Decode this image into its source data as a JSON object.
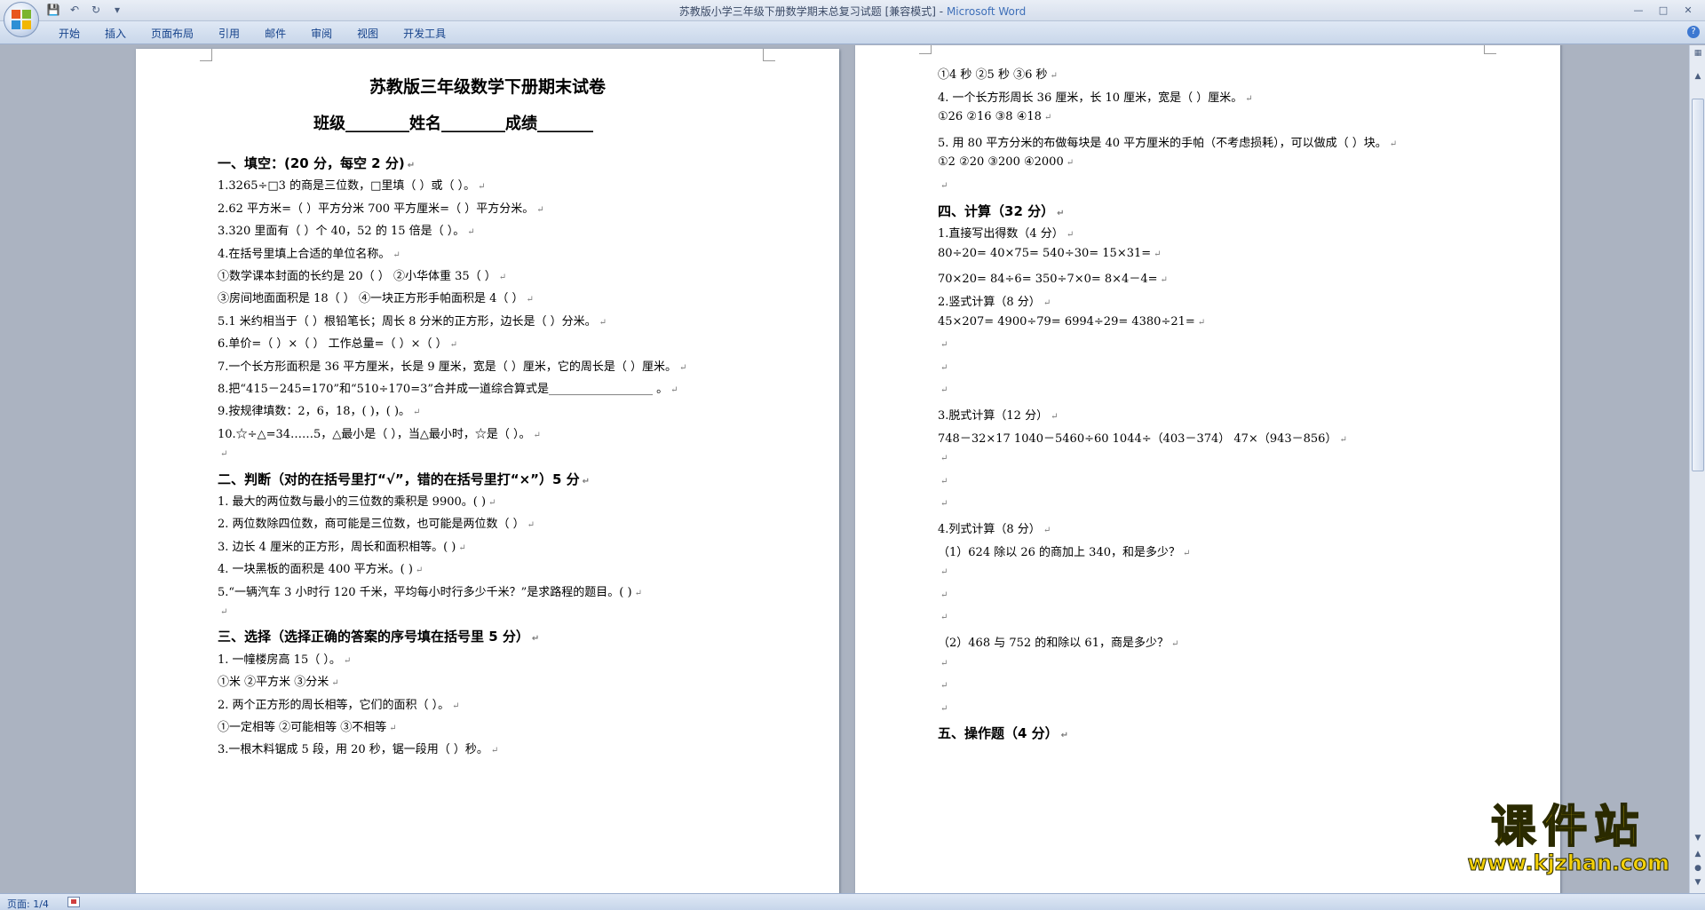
{
  "titlebar": {
    "doc_title": "苏教版小学三年级下册数学期末总复习试题 [兼容模式] -",
    "app_name": "Microsoft Word"
  },
  "ribbon": {
    "tabs": [
      "开始",
      "插入",
      "页面布局",
      "引用",
      "邮件",
      "审阅",
      "视图",
      "开发工具"
    ]
  },
  "page1": {
    "title": "苏教版三年级数学下册期末试卷",
    "info": "班级________姓名________成绩_______",
    "lines": [
      {
        "kind": "head",
        "text": "一、填空：(20 分，每空 2 分)"
      },
      {
        "kind": "body",
        "text": "1.3265÷□3 的商是三位数，□里填（      ）或（        ）。"
      },
      {
        "kind": "body",
        "text": "2.62 平方米=（      ）平方分米      700 平方厘米=（      ）平方分米。"
      },
      {
        "kind": "body",
        "text": "3.320 里面有（      ）个 40，52 的 15 倍是（      ）。"
      },
      {
        "kind": "body",
        "text": "4.在括号里填上合适的单位名称。"
      },
      {
        "kind": "body",
        "text": "①数学课本封面的长约是 20（       ）          ②小华体重 35（       ）"
      },
      {
        "kind": "body",
        "text": "③房间地面面积是 18（        ）              ④一块正方形手帕面积是 4（      ）"
      },
      {
        "kind": "body",
        "text": "5.1 米约相当于（      ）根铅笔长；周长 8 分米的正方形，边长是（      ）分米。"
      },
      {
        "kind": "body",
        "text": "6.单价=（        ）×（        ）           工作总量=（        ）×（        ）"
      },
      {
        "kind": "body",
        "text": "7.一个长方形面积是 36 平方厘米，长是 9 厘米，宽是（      ）厘米，它的周长是（    ）厘米。"
      },
      {
        "kind": "body",
        "text": "8.把“415－245=170”和“510÷170=3”合并成一道综合算式是__________________ 。"
      },
      {
        "kind": "body",
        "text": "9.按规律填数：2，6，18，(        )，(        )。"
      },
      {
        "kind": "body",
        "text": "10.☆÷△=34……5，△最小是（      ），当△最小时，☆是（      ）。"
      },
      {
        "kind": "empty",
        "text": ""
      },
      {
        "kind": "head",
        "text": "二、判断（对的在括号里打“√”，错的在括号里打“×”）5 分"
      },
      {
        "kind": "body",
        "text": "1. 最大的两位数与最小的三位数的乘积是 9900。(       )"
      },
      {
        "kind": "body",
        "text": "2. 两位数除四位数，商可能是三位数，也可能是两位数（      ）"
      },
      {
        "kind": "body",
        "text": "3. 边长 4 厘米的正方形，周长和面积相等。(      )"
      },
      {
        "kind": "body",
        "text": "4. 一块黑板的面积是 400 平方米。(        )"
      },
      {
        "kind": "body",
        "text": "5.“一辆汽车 3 小时行 120 千米，平均每小时行多少千米？”是求路程的题目。(      )"
      },
      {
        "kind": "empty",
        "text": ""
      },
      {
        "kind": "head",
        "text": "三、选择（选择正确的答案的序号填在括号里 5 分）"
      },
      {
        "kind": "body",
        "text": "1. 一幢楼房高 15（      ）。"
      },
      {
        "kind": "body",
        "text": "①米            ②平方米          ③分米"
      },
      {
        "kind": "body",
        "text": "2. 两个正方形的周长相等，它们的面积（  ）。"
      },
      {
        "kind": "body",
        "text": "①一定相等      ②可能相等      ③不相等"
      },
      {
        "kind": "body",
        "text": "3.一根木料锯成 5 段，用 20 秒，锯一段用（      ）秒。"
      }
    ]
  },
  "page2": {
    "lines": [
      {
        "kind": "body",
        "text": "①4 秒     ②5 秒      ③6 秒"
      },
      {
        "kind": "body",
        "text": "4. 一个长方形周长 36 厘米，长 10 厘米，宽是（      ）厘米。"
      },
      {
        "kind": "body",
        "text": "①26             ②16                ③8              ④18"
      },
      {
        "kind": "body",
        "text": "5. 用 80 平方分米的布做每块是 40 平方厘米的手帕（不考虑损耗），可以做成（   ）块。"
      },
      {
        "kind": "body",
        "text": "①2               ②20                ③200             ④2000"
      },
      {
        "kind": "empty",
        "text": ""
      },
      {
        "kind": "head",
        "text": "四、计算（32 分）"
      },
      {
        "kind": "body",
        "text": "1.直接写出得数（4 分）"
      },
      {
        "kind": "body",
        "text": "80÷20=          40×75=            540÷30=            15×31="
      },
      {
        "kind": "body",
        "text": "70×20=          84÷6=             350÷7×0=           8×4－4="
      },
      {
        "kind": "body",
        "text": "2.竖式计算（8 分）"
      },
      {
        "kind": "body",
        "text": "45×207=         4900÷79=           6994÷29=           4380÷21="
      },
      {
        "kind": "empty",
        "text": ""
      },
      {
        "kind": "empty",
        "text": ""
      },
      {
        "kind": "empty",
        "text": ""
      },
      {
        "kind": "body",
        "text": "3.脱式计算（12 分）"
      },
      {
        "kind": "body",
        "text": "748－32×17       1040－5460÷60      1044÷（403－374）    47×（943－856）"
      },
      {
        "kind": "empty",
        "text": ""
      },
      {
        "kind": "empty",
        "text": ""
      },
      {
        "kind": "empty",
        "text": ""
      },
      {
        "kind": "body",
        "text": "4.列式计算（8 分）"
      },
      {
        "kind": "body",
        "text": "（1）624 除以 26 的商加上 340，和是多少？"
      },
      {
        "kind": "empty",
        "text": ""
      },
      {
        "kind": "empty",
        "text": ""
      },
      {
        "kind": "empty",
        "text": ""
      },
      {
        "kind": "body",
        "text": "（2）468 与 752 的和除以 61，商是多少？"
      },
      {
        "kind": "empty",
        "text": ""
      },
      {
        "kind": "empty",
        "text": ""
      },
      {
        "kind": "empty",
        "text": ""
      },
      {
        "kind": "head",
        "text": "五、操作题（4 分）"
      }
    ]
  },
  "statusbar": {
    "page_info": "页面: 1/4"
  },
  "watermark": {
    "title": "课件站",
    "url": "www.kjzhan.com"
  },
  "colors": {
    "ribbon_text": "#15428b",
    "app_name": "#3e6fb8",
    "watermark": "#f4d10a"
  }
}
